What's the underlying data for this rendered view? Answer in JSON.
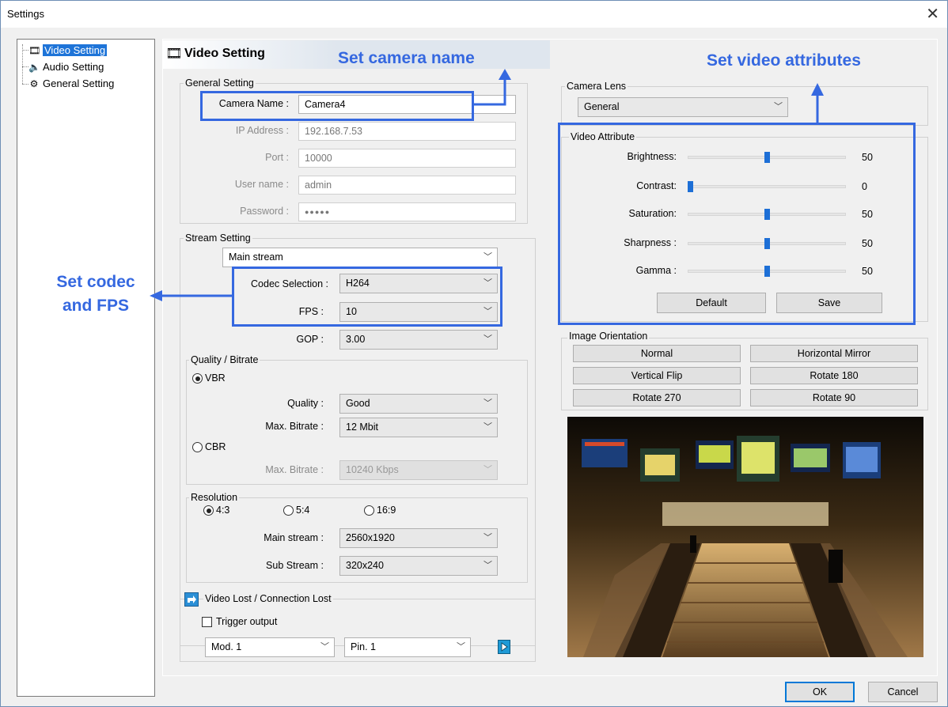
{
  "window": {
    "title": "Settings",
    "close_glyph": "✕"
  },
  "tree": {
    "items": [
      {
        "label": "Video Setting",
        "icon": "film-icon",
        "selected": true
      },
      {
        "label": "Audio Setting",
        "icon": "speaker-icon",
        "selected": false
      },
      {
        "label": "General Setting",
        "icon": "gear-icon",
        "selected": false
      }
    ]
  },
  "header": {
    "title": "Video Setting"
  },
  "general": {
    "group_title": "General Setting",
    "camera_name_label": "Camera Name :",
    "camera_name_value": "Camera4",
    "ip_label": "IP Address :",
    "ip_value": "192.168.7.53",
    "port_label": "Port :",
    "port_value": "10000",
    "user_label": "User name :",
    "user_value": "admin",
    "password_label": "Password :",
    "password_value": "●●●●●"
  },
  "stream": {
    "group_title": "Stream Setting",
    "stream_select": "Main stream",
    "codec_label": "Codec Selection :",
    "codec_value": "H264",
    "fps_label": "FPS :",
    "fps_value": "10",
    "gop_label": "GOP :",
    "gop_value": "3.00"
  },
  "quality": {
    "group_title": "Quality / Bitrate",
    "vbr_label": "VBR",
    "quality_label": "Quality :",
    "quality_value": "Good",
    "max_bitrate_label": "Max. Bitrate :",
    "max_bitrate_value": "12 Mbit",
    "cbr_label": "CBR",
    "cbr_max_bitrate_label": "Max. Bitrate :",
    "cbr_max_bitrate_value": "10240  Kbps"
  },
  "resolution": {
    "group_title": "Resolution",
    "ratio_43": "4:3",
    "ratio_54": "5:4",
    "ratio_169": "16:9",
    "main_label": "Main stream :",
    "main_value": "2560x1920",
    "sub_label": "Sub Stream :",
    "sub_value": "320x240"
  },
  "video_lost": {
    "group_title": "Video Lost / Connection Lost",
    "trigger_label": "Trigger output",
    "mod_value": "Mod. 1",
    "pin_value": "Pin. 1"
  },
  "lens": {
    "group_title": "Camera Lens",
    "value": "General"
  },
  "attributes": {
    "group_title": "Video Attribute",
    "rows": [
      {
        "label": "Brightness:",
        "value": "50",
        "level": 0.5
      },
      {
        "label": "Contrast:",
        "value": "0",
        "level": 0.0
      },
      {
        "label": "Saturation:",
        "value": "50",
        "level": 0.5
      },
      {
        "label": "Sharpness :",
        "value": "50",
        "level": 0.5
      },
      {
        "label": "Gamma :",
        "value": "50",
        "level": 0.5
      }
    ],
    "default_label": "Default",
    "save_label": "Save"
  },
  "orientation": {
    "group_title": "Image Orientation",
    "buttons": [
      "Normal",
      "Horizontal Mirror",
      "Vertical Flip",
      "Rotate 180",
      "Rotate 270",
      "Rotate 90"
    ]
  },
  "footer": {
    "ok_label": "OK",
    "cancel_label": "Cancel"
  },
  "annotations": {
    "camera_name": "Set camera name",
    "video_attributes": "Set video attributes",
    "codec_fps_line1": "Set codec",
    "codec_fps_line2": "and FPS",
    "color": "#3568e0"
  }
}
